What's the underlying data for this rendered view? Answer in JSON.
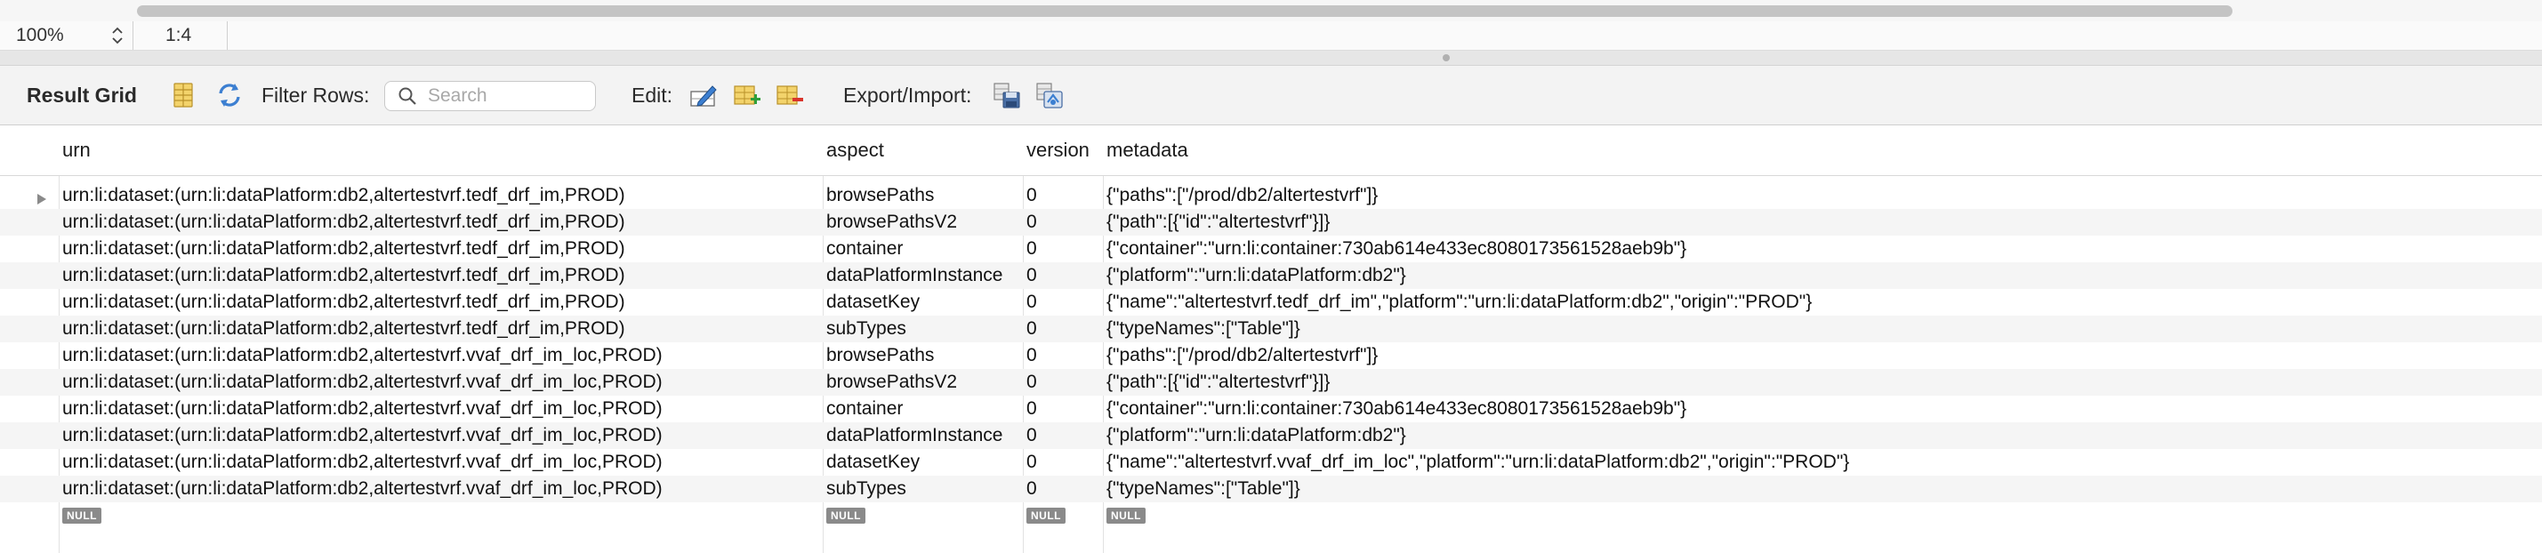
{
  "zoom": {
    "value": "100%",
    "ratio": "1:4"
  },
  "toolbar": {
    "title": "Result Grid",
    "filter_label": "Filter Rows:",
    "search_placeholder": "Search",
    "search_value": "",
    "edit_label": "Edit:",
    "export_label": "Export/Import:"
  },
  "grid": {
    "columns": [
      "urn",
      "aspect",
      "version",
      "metadata"
    ],
    "rows": [
      [
        "urn:li:dataset:(urn:li:dataPlatform:db2,altertestvrf.tedf_drf_im,PROD)",
        "browsePaths",
        "0",
        "{\"paths\":[\"/prod/db2/altertestvrf\"]}"
      ],
      [
        "urn:li:dataset:(urn:li:dataPlatform:db2,altertestvrf.tedf_drf_im,PROD)",
        "browsePathsV2",
        "0",
        "{\"path\":[{\"id\":\"altertestvrf\"}]}"
      ],
      [
        "urn:li:dataset:(urn:li:dataPlatform:db2,altertestvrf.tedf_drf_im,PROD)",
        "container",
        "0",
        "{\"container\":\"urn:li:container:730ab614e433ec8080173561528aeb9b\"}"
      ],
      [
        "urn:li:dataset:(urn:li:dataPlatform:db2,altertestvrf.tedf_drf_im,PROD)",
        "dataPlatformInstance",
        "0",
        "{\"platform\":\"urn:li:dataPlatform:db2\"}"
      ],
      [
        "urn:li:dataset:(urn:li:dataPlatform:db2,altertestvrf.tedf_drf_im,PROD)",
        "datasetKey",
        "0",
        "{\"name\":\"altertestvrf.tedf_drf_im\",\"platform\":\"urn:li:dataPlatform:db2\",\"origin\":\"PROD\"}"
      ],
      [
        "urn:li:dataset:(urn:li:dataPlatform:db2,altertestvrf.tedf_drf_im,PROD)",
        "subTypes",
        "0",
        "{\"typeNames\":[\"Table\"]}"
      ],
      [
        "urn:li:dataset:(urn:li:dataPlatform:db2,altertestvrf.vvaf_drf_im_loc,PROD)",
        "browsePaths",
        "0",
        "{\"paths\":[\"/prod/db2/altertestvrf\"]}"
      ],
      [
        "urn:li:dataset:(urn:li:dataPlatform:db2,altertestvrf.vvaf_drf_im_loc,PROD)",
        "browsePathsV2",
        "0",
        "{\"path\":[{\"id\":\"altertestvrf\"}]}"
      ],
      [
        "urn:li:dataset:(urn:li:dataPlatform:db2,altertestvrf.vvaf_drf_im_loc,PROD)",
        "container",
        "0",
        "{\"container\":\"urn:li:container:730ab614e433ec8080173561528aeb9b\"}"
      ],
      [
        "urn:li:dataset:(urn:li:dataPlatform:db2,altertestvrf.vvaf_drf_im_loc,PROD)",
        "dataPlatformInstance",
        "0",
        "{\"platform\":\"urn:li:dataPlatform:db2\"}"
      ],
      [
        "urn:li:dataset:(urn:li:dataPlatform:db2,altertestvrf.vvaf_drf_im_loc,PROD)",
        "datasetKey",
        "0",
        "{\"name\":\"altertestvrf.vvaf_drf_im_loc\",\"platform\":\"urn:li:dataPlatform:db2\",\"origin\":\"PROD\"}"
      ],
      [
        "urn:li:dataset:(urn:li:dataPlatform:db2,altertestvrf.vvaf_drf_im_loc,PROD)",
        "subTypes",
        "0",
        "{\"typeNames\":[\"Table\"]}"
      ]
    ],
    "null_label": "NULL"
  }
}
